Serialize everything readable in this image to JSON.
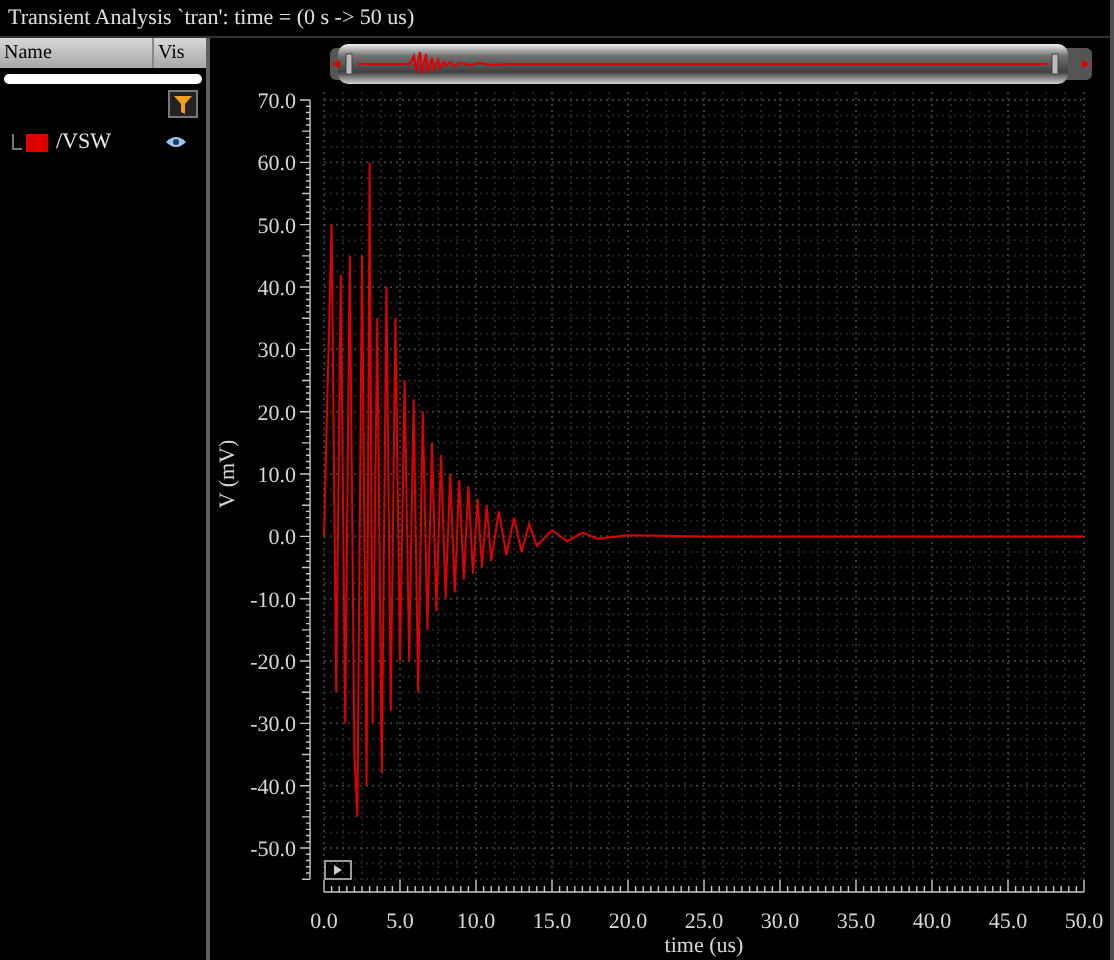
{
  "title": "Transient Analysis `tran': time = (0 s -> 50 us)",
  "signal_list": {
    "columns": [
      "Name",
      "Vis"
    ],
    "items": [
      {
        "name": "/VSW",
        "color": "#e00000",
        "visible": true
      }
    ]
  },
  "plot": {
    "chart_data": {
      "type": "line",
      "grid": true,
      "xlabel": "time (us)",
      "ylabel": "V (mV)",
      "xlim": [
        0,
        50
      ],
      "ylim": [
        -55,
        70
      ],
      "xticks": [
        {
          "value": 0,
          "label": "0.0"
        },
        {
          "value": 5,
          "label": "5.0"
        },
        {
          "value": 10,
          "label": "10.0"
        },
        {
          "value": 15,
          "label": "15.0"
        },
        {
          "value": 20,
          "label": "20.0"
        },
        {
          "value": 25,
          "label": "25.0"
        },
        {
          "value": 30,
          "label": "30.0"
        },
        {
          "value": 35,
          "label": "35.0"
        },
        {
          "value": 40,
          "label": "40.0"
        },
        {
          "value": 45,
          "label": "45.0"
        },
        {
          "value": 50,
          "label": "50.0"
        }
      ],
      "yticks": [
        {
          "value": 70,
          "label": "70.0"
        },
        {
          "value": 60,
          "label": "60.0"
        },
        {
          "value": 50,
          "label": "50.0"
        },
        {
          "value": 40,
          "label": "40.0"
        },
        {
          "value": 30,
          "label": "30.0"
        },
        {
          "value": 20,
          "label": "20.0"
        },
        {
          "value": 10,
          "label": "10.0"
        },
        {
          "value": 0,
          "label": "0.0"
        },
        {
          "value": -10,
          "label": "-10.0"
        },
        {
          "value": -20,
          "label": "-20.0"
        },
        {
          "value": -30,
          "label": "-30.0"
        },
        {
          "value": -40,
          "label": "-40.0"
        },
        {
          "value": -50,
          "label": "-50.0"
        }
      ],
      "x": [
        0,
        0.5,
        0.8,
        1.1,
        1.4,
        1.7,
        2.0,
        2.2,
        2.5,
        2.8,
        3.0,
        3.2,
        3.5,
        3.8,
        4.1,
        4.4,
        4.7,
        5.0,
        5.3,
        5.6,
        5.9,
        6.2,
        6.5,
        6.8,
        7.1,
        7.4,
        7.7,
        8.0,
        8.3,
        8.6,
        8.9,
        9.2,
        9.5,
        9.8,
        10.1,
        10.4,
        10.7,
        11.0,
        11.5,
        12,
        12.5,
        13,
        13.5,
        14,
        15,
        16,
        17,
        18,
        20,
        25,
        30,
        35,
        40,
        45,
        50
      ],
      "series": [
        {
          "color": "#e00000",
          "values": [
            0,
            50,
            -25,
            42,
            -30,
            45,
            -35,
            -45,
            45,
            -40,
            60,
            -30,
            35,
            -38,
            40,
            -28,
            35,
            -20,
            25,
            -20,
            22,
            -25,
            20,
            -15,
            15,
            -12,
            13,
            -10,
            10,
            -9,
            9,
            -7,
            8,
            -6,
            6,
            -5,
            5,
            -4,
            4,
            -3,
            3,
            -2.5,
            2,
            -1.5,
            1,
            -0.8,
            0.6,
            -0.4,
            0.2,
            0,
            0,
            0,
            0,
            0,
            0
          ]
        }
      ]
    }
  }
}
